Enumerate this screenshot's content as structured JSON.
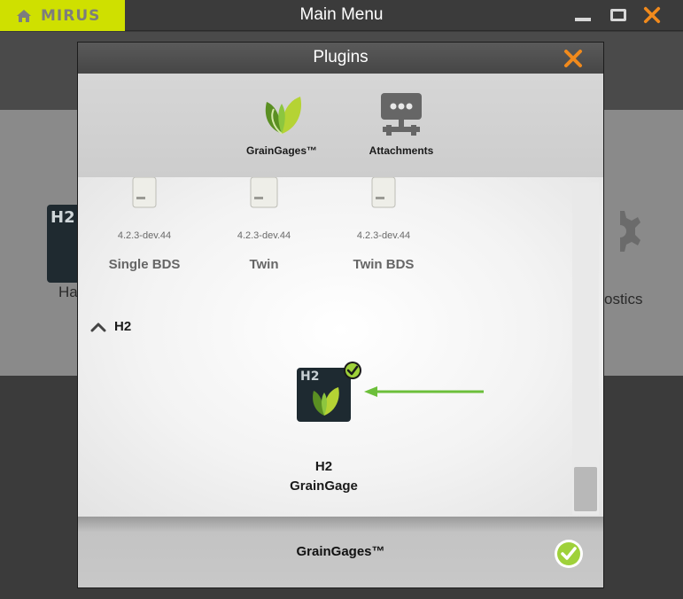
{
  "app": {
    "logo_text": "MIRUS",
    "window_title": "Main Menu"
  },
  "background_menu": {
    "partial_label_left": "Ha",
    "partial_label_right": "ostics",
    "tile_text": "H2"
  },
  "dialog": {
    "title": "Plugins",
    "plugins": [
      {
        "label": "GrainGages™",
        "icon": "graingages-leaf-icon"
      },
      {
        "label": "Attachments",
        "icon": "attachments-network-icon"
      }
    ],
    "devices": [
      {
        "version": "4.2.3-dev.44",
        "name": "Single BDS"
      },
      {
        "version": "4.2.3-dev.44",
        "name": "Twin"
      },
      {
        "version": "4.2.3-dev.44",
        "name": "Twin BDS"
      }
    ],
    "section": {
      "label": "H2",
      "expanded": true
    },
    "h2_item": {
      "tile_text": "H2",
      "name_line1": "H2",
      "name_line2": "GrainGage",
      "selected": true
    },
    "footer_label": "GrainGages™"
  },
  "colors": {
    "brand_yellow": "#cfe000",
    "accent_orange": "#f18a1c",
    "leaf_green": "#8cc63f",
    "arrow_green": "#6cbf3a"
  }
}
